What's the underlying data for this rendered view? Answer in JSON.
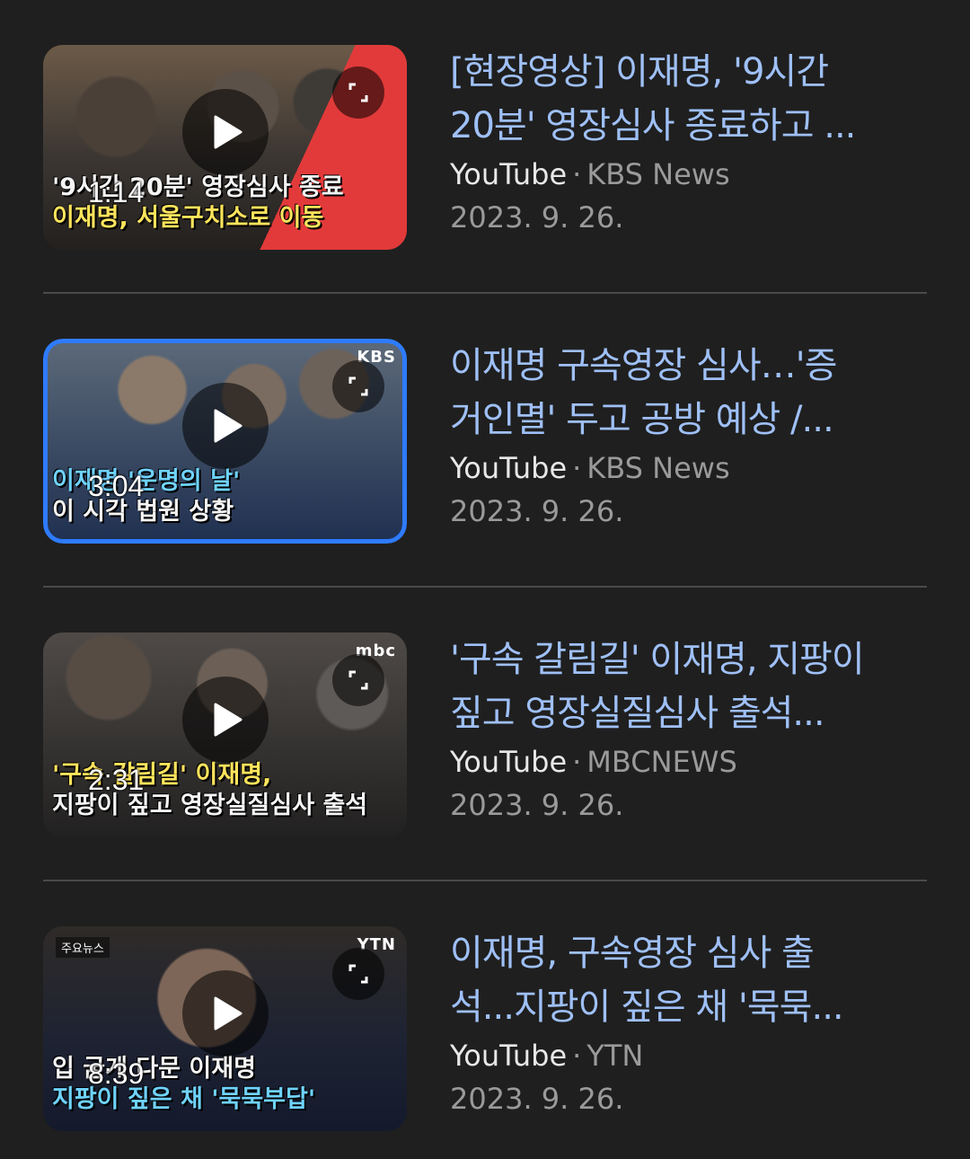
{
  "results": [
    {
      "title_lines": [
        "[현장영상] 이재명, '9시간",
        "20분' 영장심사 종료하고 ..."
      ],
      "source": "YouTube",
      "channel": "KBS News",
      "date": "2023. 9. 26.",
      "duration": "1:14",
      "thumbnail": {
        "caption_lines": [
          "'9시간 20분' 영장심사 종료",
          "이재명, 서울구치소로 이동"
        ],
        "badge": "",
        "accent_color": "#e23a3a"
      }
    },
    {
      "title_lines": [
        "이재명 구속영장 심사…'증",
        "거인멸' 두고 공방 예상 /..."
      ],
      "source": "YouTube",
      "channel": "KBS News",
      "date": "2023. 9. 26.",
      "duration": "3:04",
      "thumbnail": {
        "caption_lines": [
          "이재명 '운명의 날'",
          "이 시각 법원 상황"
        ],
        "badge": "KBS",
        "accent_color": "#2e7bff"
      }
    },
    {
      "title_lines": [
        "'구속 갈림길' 이재명, 지팡이",
        "짚고 영장실질심사 출석..."
      ],
      "source": "YouTube",
      "channel": "MBCNEWS",
      "date": "2023. 9. 26.",
      "duration": "2:31",
      "thumbnail": {
        "caption_lines": [
          "'구속 갈림길' 이재명,",
          "지팡이 짚고 영장실질심사 출석"
        ],
        "badge": "mbc",
        "accent_color": "#2b3d8f"
      }
    },
    {
      "title_lines": [
        "이재명, 구속영장 심사 출",
        "석...지팡이 짚은 채 '묵묵..."
      ],
      "source": "YouTube",
      "channel": "YTN",
      "date": "2023. 9. 26.",
      "duration": "8:39",
      "thumbnail": {
        "caption_lines": [
          "입 굳게 다문 이재명",
          "지팡이 짚은 채 '묵묵부답'"
        ],
        "badge": "YTN",
        "badge_left": "주요뉴스",
        "accent_color": "#1a2a66"
      }
    }
  ],
  "colors": {
    "background": "#1f1f1f",
    "title": "#9fc0f7",
    "source": "#e8e8e8",
    "meta": "#9a9a9a",
    "divider": "#4a4a4a"
  },
  "icons": {
    "play": "play-icon",
    "expand": "expand-icon"
  }
}
